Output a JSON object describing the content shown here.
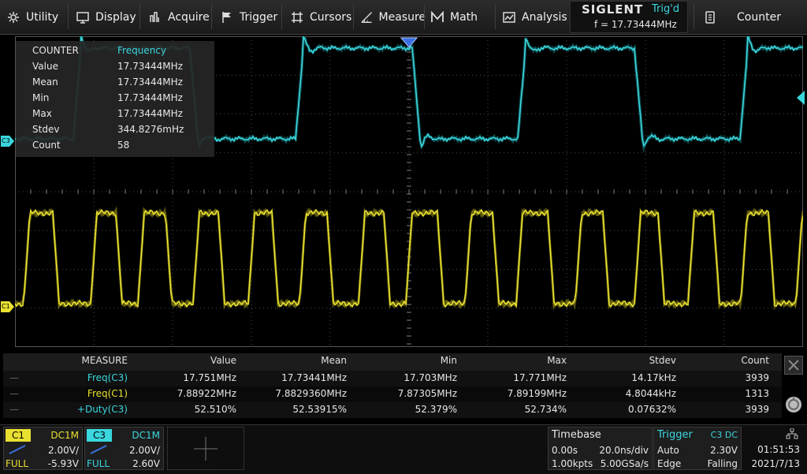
{
  "menu": {
    "items": [
      {
        "label": "Utility",
        "icon": "gear-icon"
      },
      {
        "label": "Display",
        "icon": "monitor-icon"
      },
      {
        "label": "Acquire",
        "icon": "acquire-icon"
      },
      {
        "label": "Trigger",
        "icon": "flag-icon"
      },
      {
        "label": "Cursors",
        "icon": "cursor-crosshair-icon"
      },
      {
        "label": "Measure",
        "icon": "measure-icon"
      },
      {
        "label": "Math",
        "icon": "math-icon"
      },
      {
        "label": "Analysis",
        "icon": "analysis-icon"
      }
    ],
    "brand": "SIGLENT",
    "trig_status": "Trig'd",
    "trig_freq": "f = 17.73444MHz",
    "counter_label": "Counter"
  },
  "counter": {
    "title": "COUNTER",
    "mode": "Frequency",
    "rows": [
      {
        "label": "Value",
        "value": "17.73444MHz"
      },
      {
        "label": "Mean",
        "value": "17.73444MHz"
      },
      {
        "label": "Min",
        "value": "17.73444MHz"
      },
      {
        "label": "Max",
        "value": "17.73444MHz"
      },
      {
        "label": "Stdev",
        "value": "344.8276mHz"
      },
      {
        "label": "Count",
        "value": "58"
      }
    ]
  },
  "markers": {
    "c3": "C3",
    "c1": "C1"
  },
  "measure": {
    "headers": [
      "MEASURE",
      "Value",
      "Mean",
      "Min",
      "Max",
      "Stdev",
      "Count"
    ],
    "rows": [
      {
        "name": "Freq(C3)",
        "color": "#3ad7de",
        "cells": [
          "17.751MHz",
          "17.73441MHz",
          "17.703MHz",
          "17.771MHz",
          "14.17kHz",
          "3939"
        ]
      },
      {
        "name": "Freq(C1)",
        "color": "#e8e030",
        "cells": [
          "7.88922MHz",
          "7.8829360MHz",
          "7.87305MHz",
          "7.89199MHz",
          "4.8044kHz",
          "1313"
        ]
      },
      {
        "name": "+Duty(C3)",
        "color": "#3ad7de",
        "cells": [
          "52.510%",
          "52.53915%",
          "52.379%",
          "52.734%",
          "0.07632%",
          "3939"
        ]
      }
    ]
  },
  "channels": [
    {
      "name": "C1",
      "coupling": "DC1M",
      "scale": "2.00V/",
      "bw": "FULL",
      "offset": "-5.93V",
      "color": "#e8e030"
    },
    {
      "name": "C3",
      "coupling": "DC1M",
      "scale": "2.00V/",
      "bw": "FULL",
      "offset": "2.60V",
      "color": "#3ad7de"
    }
  ],
  "timebase": {
    "title": "Timebase",
    "delay": "0.00s",
    "scale": "20.0ns/div",
    "points": "1.00kpts",
    "rate": "5.00GSa/s"
  },
  "trigger": {
    "title": "Trigger",
    "source": "C3 DC",
    "mode": "Auto",
    "level": "2.30V",
    "type": "Edge",
    "slope": "Falling"
  },
  "clock": {
    "time": "01:51:53",
    "date": "2021/7/13"
  },
  "colors": {
    "c1": "#e8e030",
    "c3": "#3ad7de",
    "grid": "#4a4a4a",
    "accent": "#3ad7de"
  }
}
